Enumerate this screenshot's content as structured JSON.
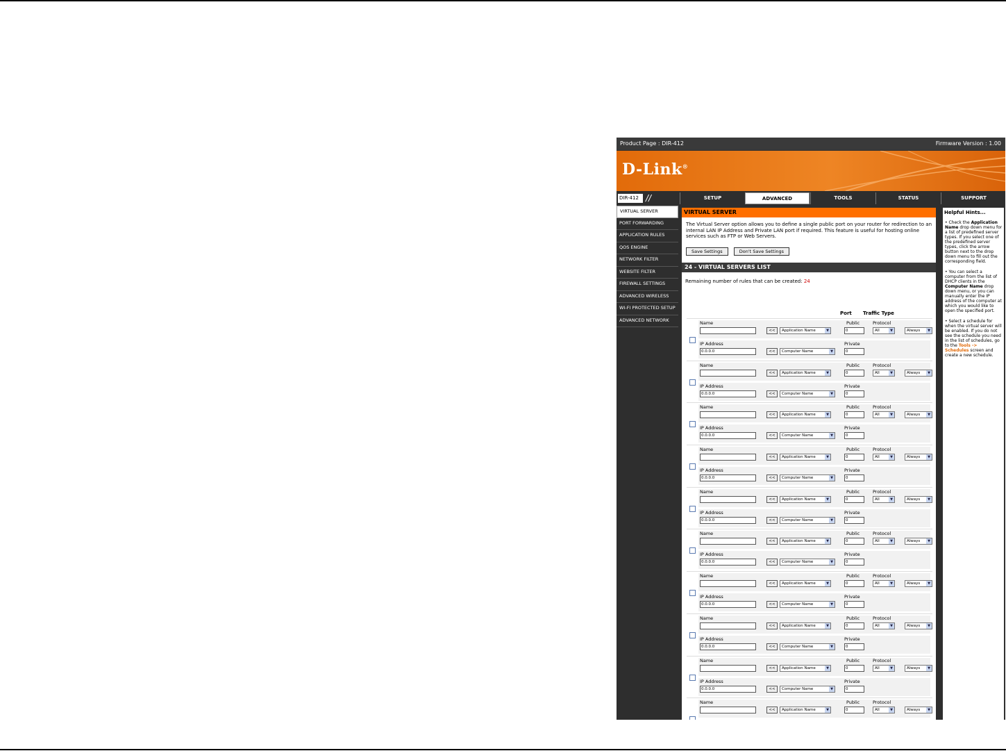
{
  "header": {
    "product_page": "Product Page : DIR-412",
    "firmware": "Firmware Version : 1.00",
    "logo": "D-Link",
    "model": "DIR-412"
  },
  "tabs": [
    {
      "label": "SETUP",
      "active": false
    },
    {
      "label": "ADVANCED",
      "active": true
    },
    {
      "label": "TOOLS",
      "active": false
    },
    {
      "label": "STATUS",
      "active": false
    },
    {
      "label": "SUPPORT",
      "active": false
    }
  ],
  "sidebar": [
    "VIRTUAL SERVER",
    "PORT FORWARDING",
    "APPLICATION RULES",
    "QOS ENGINE",
    "NETWORK FILTER",
    "WEBSITE FILTER",
    "FIREWALL SETTINGS",
    "ADVANCED WIRELESS",
    "WI-FI PROTECTED SETUP",
    "ADVANCED NETWORK"
  ],
  "virtual_server": {
    "title": "VIRTUAL SERVER",
    "description": "The Virtual Server option allows you to define a single public port on your router for redirection to an internal LAN IP Address and Private LAN port if required. This feature is useful for hosting online services such as FTP or Web Servers.",
    "save_label": "Save Settings",
    "dont_save_label": "Don't Save Settings"
  },
  "list": {
    "title": "24 - VIRTUAL SERVERS LIST",
    "remaining_label": "Remaining number of rules that can be created:",
    "remaining_count": "24",
    "col_port": "Port",
    "col_traffic": "Traffic Type",
    "name_label": "Name",
    "ip_label": "IP Address",
    "public_label": "Public",
    "private_label": "Private",
    "protocol_label": "Protocol",
    "arrow_label": "<<",
    "app_name": "Application Name",
    "computer_name": "Computer Name",
    "ip_default": "0.0.0.0",
    "port_default": "0",
    "protocol_value": "All",
    "schedule_value": "Always",
    "row_count": 10
  },
  "hints": {
    "title": "Helpful Hints...",
    "hint1_a": "• Check the ",
    "hint1_b": "Application Name",
    "hint1_c": " drop down menu for a list of predefined server types. If you select one of the predefined server types, click the arrow button next to the drop down menu to fill out the corresponding field.",
    "hint2_a": "• You can select a computer from the list of DHCP clients in the ",
    "hint2_b": "Computer Name",
    "hint2_c": " drop down menu, or you can manually enter the IP address of the computer at which you would like to open the specified port.",
    "hint3_a": "• Select a schedule for when the virtual server will be enabled. If you do not see the schedule you need in the list of schedules, go to the ",
    "hint3_b": "Tools -> Schedules",
    "hint3_c": " screen and create a new schedule."
  }
}
